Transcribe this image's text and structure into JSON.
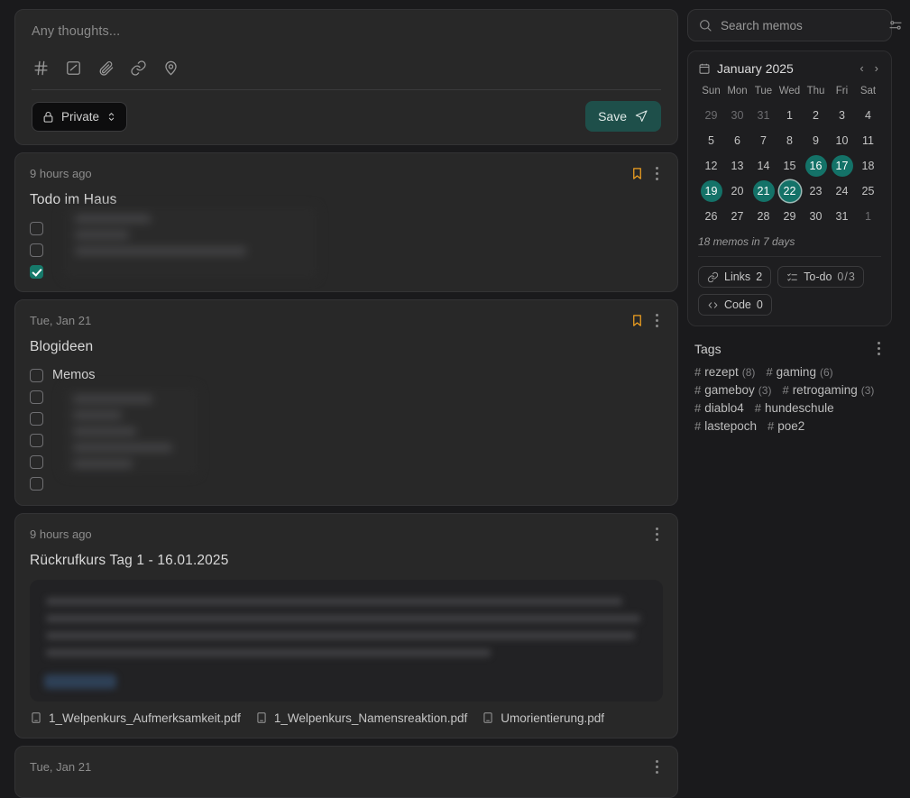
{
  "editor": {
    "placeholder": "Any thoughts...",
    "tools": [
      {
        "name": "hash-icon",
        "label": "#"
      },
      {
        "name": "checkbox-list-icon",
        "label": "todo"
      },
      {
        "name": "paperclip-icon",
        "label": "attach"
      },
      {
        "name": "link-icon",
        "label": "link"
      },
      {
        "name": "location-pin-icon",
        "label": "location"
      }
    ],
    "visibility_label": "Private",
    "save_label": "Save",
    "save_color": "#1e4f4a"
  },
  "memos": [
    {
      "time": "9 hours ago",
      "title": "Todo im Haus",
      "bookmarked": true,
      "bookmark_color": "#f0a020",
      "todos": [
        {
          "label": "",
          "checked": false,
          "redacted": true
        },
        {
          "label": "",
          "checked": false,
          "redacted": true
        },
        {
          "label": "",
          "checked": true,
          "redacted": true
        }
      ]
    },
    {
      "time": "Tue, Jan 21",
      "title": "Blogideen",
      "bookmarked": true,
      "bookmark_color": "#f0a020",
      "todos": [
        {
          "label": "Memos",
          "checked": false,
          "redacted": false
        },
        {
          "label": "",
          "checked": false,
          "redacted": true
        },
        {
          "label": "",
          "checked": false,
          "redacted": true
        },
        {
          "label": "",
          "checked": false,
          "redacted": true
        },
        {
          "label": "",
          "checked": false,
          "redacted": true
        },
        {
          "label": "",
          "checked": false,
          "redacted": true
        }
      ]
    },
    {
      "time": "9 hours ago",
      "title": "Rückrufkurs Tag 1 - 16.01.2025",
      "bookmarked": false,
      "body_redacted": true,
      "attachments": [
        "1_Welpenkurs_Aufmerksamkeit.pdf",
        "1_Welpenkurs_Namensreaktion.pdf",
        "Umorientierung.pdf"
      ]
    },
    {
      "time": "Tue, Jan 21",
      "title": "",
      "bookmarked": false
    }
  ],
  "sidebar": {
    "search": {
      "placeholder": "Search memos",
      "value": ""
    },
    "calendar": {
      "month_label": "January 2025",
      "prev_label": "‹",
      "next_label": "›",
      "weekdays": [
        "Sun",
        "Mon",
        "Tue",
        "Wed",
        "Thu",
        "Fri",
        "Sat"
      ],
      "weeks": [
        [
          {
            "d": "29",
            "state": "muted"
          },
          {
            "d": "30",
            "state": "muted"
          },
          {
            "d": "31",
            "state": "muted"
          },
          {
            "d": "1",
            "state": "normal"
          },
          {
            "d": "2",
            "state": "normal"
          },
          {
            "d": "3",
            "state": "normal"
          },
          {
            "d": "4",
            "state": "normal"
          }
        ],
        [
          {
            "d": "5",
            "state": "normal"
          },
          {
            "d": "6",
            "state": "normal"
          },
          {
            "d": "7",
            "state": "normal"
          },
          {
            "d": "8",
            "state": "normal"
          },
          {
            "d": "9",
            "state": "normal"
          },
          {
            "d": "10",
            "state": "normal"
          },
          {
            "d": "11",
            "state": "normal"
          }
        ],
        [
          {
            "d": "12",
            "state": "normal"
          },
          {
            "d": "13",
            "state": "normal"
          },
          {
            "d": "14",
            "state": "normal"
          },
          {
            "d": "15",
            "state": "normal"
          },
          {
            "d": "16",
            "state": "active"
          },
          {
            "d": "17",
            "state": "active"
          },
          {
            "d": "18",
            "state": "normal"
          }
        ],
        [
          {
            "d": "19",
            "state": "active"
          },
          {
            "d": "20",
            "state": "normal"
          },
          {
            "d": "21",
            "state": "active"
          },
          {
            "d": "22",
            "state": "today"
          },
          {
            "d": "23",
            "state": "normal"
          },
          {
            "d": "24",
            "state": "normal"
          },
          {
            "d": "25",
            "state": "normal"
          }
        ],
        [
          {
            "d": "26",
            "state": "normal"
          },
          {
            "d": "27",
            "state": "normal"
          },
          {
            "d": "28",
            "state": "normal"
          },
          {
            "d": "29",
            "state": "normal"
          },
          {
            "d": "30",
            "state": "normal"
          },
          {
            "d": "31",
            "state": "normal"
          },
          {
            "d": "1",
            "state": "muted"
          }
        ]
      ],
      "summary": "18 memos in 7 days",
      "highlight_color": "#147268"
    },
    "stats": [
      {
        "icon": "link-icon",
        "label": "Links",
        "value": "2"
      },
      {
        "icon": "todo-icon",
        "label": "To-do",
        "value": "0",
        "total": "3"
      },
      {
        "icon": "code-icon",
        "label": "Code",
        "value": "0"
      }
    ],
    "tags": {
      "title": "Tags",
      "items": [
        {
          "name": "rezept",
          "count": "(8)"
        },
        {
          "name": "gaming",
          "count": "(6)"
        },
        {
          "name": "gameboy",
          "count": "(3)"
        },
        {
          "name": "retrogaming",
          "count": "(3)"
        },
        {
          "name": "diablo4",
          "count": ""
        },
        {
          "name": "hundeschule",
          "count": ""
        },
        {
          "name": "lastepoch",
          "count": ""
        },
        {
          "name": "poe2",
          "count": ""
        }
      ]
    }
  }
}
